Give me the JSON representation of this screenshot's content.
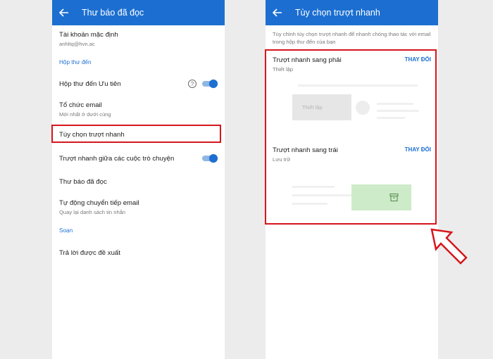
{
  "left": {
    "title": "Thư báo đã đọc",
    "account": {
      "label": "Tài khoản mặc định",
      "value": "anhltq@hvn.ac"
    },
    "section_inbox": "Hộp thư đến",
    "focused_inbox": "Hộp thư đến Ưu tiên",
    "organize": {
      "label": "Tổ chức email",
      "value": "Mới nhất ở dưới cùng"
    },
    "swipe_options": "Tùy chọn trượt nhanh",
    "swipe_conversations": "Trượt nhanh giữa các cuộc trò chuyện",
    "mark_read": "Thư báo đã đọc",
    "auto_advance": {
      "label": "Tự động chuyển tiếp email",
      "value": "Quay lại danh sách tin nhắn"
    },
    "section_compose": "Soạn",
    "suggested_replies": "Trả lời được đề xuất",
    "help_glyph": "?",
    "toggles": {
      "focused_inbox": true,
      "swipe_conversations": true
    }
  },
  "right": {
    "title": "Tùy chọn trượt nhanh",
    "description": "Tùy chỉnh tùy chọn trượt nhanh để nhanh chóng thao tác với email trong hộp thư đến của bạn",
    "swipe_right": {
      "label": "Trượt nhanh sang phải",
      "value": "Thiết lập",
      "change": "THAY ĐỔI",
      "preview_label": "Thiết lập"
    },
    "swipe_left": {
      "label": "Trượt nhanh sang trái",
      "value": "Lưu trữ",
      "change": "THAY ĐỔI"
    }
  },
  "colors": {
    "accent": "#1c6fd1",
    "highlight": "#d5161c",
    "archive_green": "#cdebc8"
  },
  "icons": {
    "back": "arrow-left-icon",
    "help": "help-circle-icon",
    "archive": "archive-icon",
    "pointer": "outline-arrow-icon"
  }
}
